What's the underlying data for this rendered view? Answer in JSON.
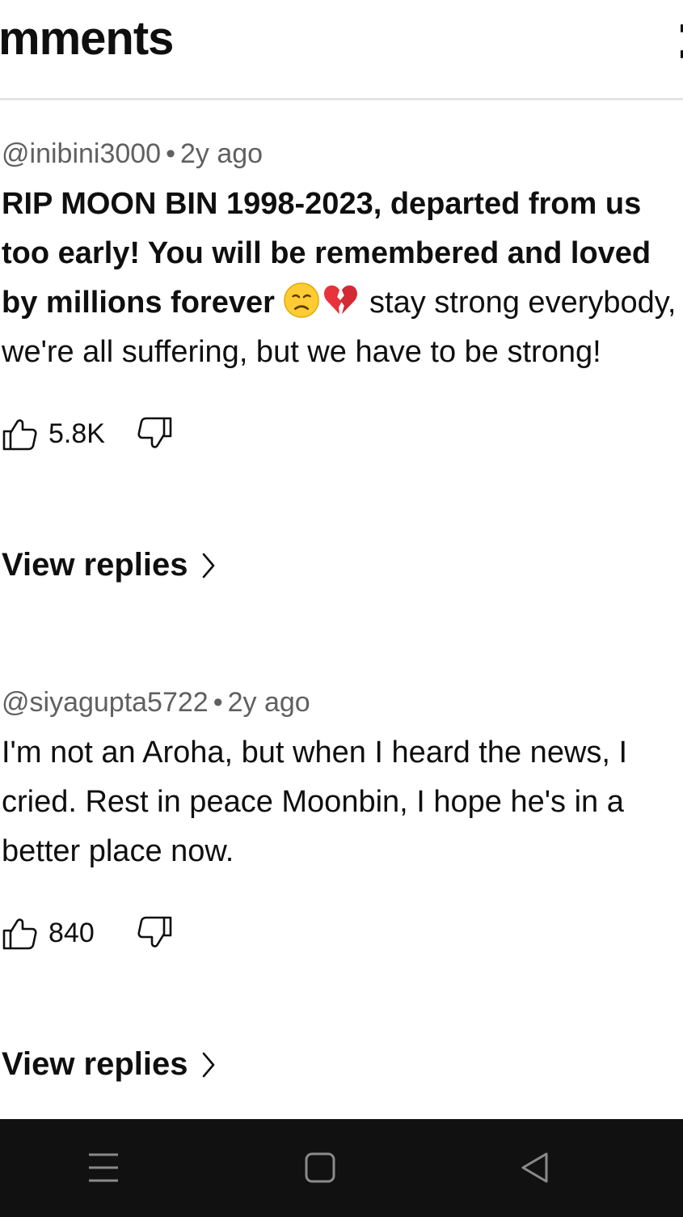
{
  "header": {
    "title": "mments"
  },
  "comments": [
    {
      "author": "@inibini3000",
      "separator": "•",
      "time": "2y ago",
      "text_bold": "RIP MOON BIN 1998-2023, departed from us too early! You will be remembered and loved by millions forever ",
      "emojis": [
        "disappointed-face-emoji",
        "broken-heart-emoji"
      ],
      "text_regular": " stay strong everybody, we're all suffering, but we have to be strong!",
      "likes": "5.8K",
      "view_replies": "View replies"
    },
    {
      "author": "@siyagupta5722",
      "separator": "•",
      "time": "2y ago",
      "text_regular": "I'm not an Aroha, but when I heard the news, I cried. Rest in peace Moonbin, I hope he's in a better place now.",
      "likes": "840",
      "view_replies": "View replies"
    }
  ],
  "navbar": {
    "icons": [
      "menu-icon",
      "home-square-icon",
      "back-triangle-icon"
    ],
    "background": "#111111"
  },
  "colors": {
    "meta": "#606060",
    "text": "#0f0f0f",
    "divider": "#e5e5e5"
  }
}
